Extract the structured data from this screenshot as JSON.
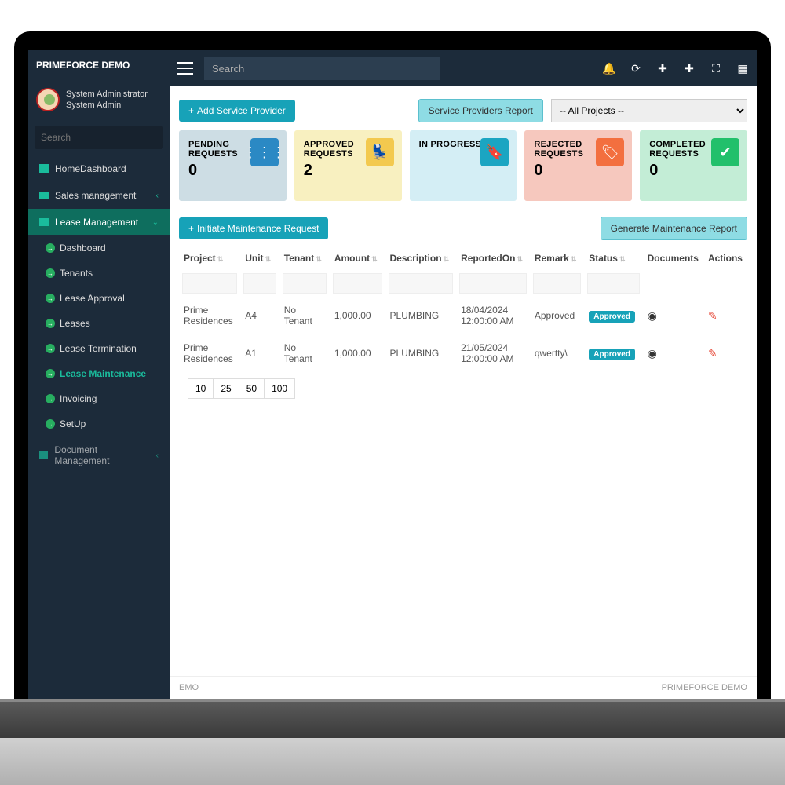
{
  "brand": "PRIMEFORCE DEMO",
  "user": {
    "name": "System Administrator",
    "role": "System Admin"
  },
  "topSearchPlaceholder": "Search",
  "sideSearchPlaceholder": "Search",
  "menu": {
    "home": "HomeDashboard",
    "sales": "Sales management",
    "lease": "Lease Management",
    "docmgmt": "Document Management",
    "sub": {
      "dashboard": "Dashboard",
      "tenants": "Tenants",
      "leaseApproval": "Lease Approval",
      "leases": "Leases",
      "leaseTermination": "Lease Termination",
      "leaseMaintenance": "Lease Maintenance",
      "invoicing": "Invoicing",
      "setup": "SetUp"
    }
  },
  "buttons": {
    "addServiceProvider": "Add Service Provider",
    "serviceProvidersReport": "Service Providers Report",
    "initiateRequest": "Initiate Maintenance Request",
    "generateReport": "Generate Maintenance Report"
  },
  "projectSelect": "-- All Projects --",
  "cards": {
    "pending": {
      "title": "PENDING REQUESTS",
      "value": "0"
    },
    "approved": {
      "title": "APPROVED REQUESTS",
      "value": "2"
    },
    "inprogress": {
      "title": "IN PROGRESS",
      "value": ""
    },
    "rejected": {
      "title": "REJECTED REQUESTS",
      "value": "0"
    },
    "completed": {
      "title": "COMPLETED REQUESTS",
      "value": "0"
    }
  },
  "table": {
    "headers": {
      "project": "Project",
      "unit": "Unit",
      "tenant": "Tenant",
      "amount": "Amount",
      "description": "Description",
      "reportedOn": "ReportedOn",
      "remark": "Remark",
      "status": "Status",
      "documents": "Documents",
      "actions": "Actions"
    },
    "rows": [
      {
        "project": "Prime Residences",
        "unit": "A4",
        "tenant": "No Tenant",
        "amount": "1,000.00",
        "description": "PLUMBING",
        "reportedOn": "18/04/2024 12:00:00 AM",
        "remark": "Approved",
        "status": "Approved"
      },
      {
        "project": "Prime Residences",
        "unit": "A1",
        "tenant": "No Tenant",
        "amount": "1,000.00",
        "description": "PLUMBING",
        "reportedOn": "21/05/2024 12:00:00 AM",
        "remark": "qwertty\\",
        "status": "Approved"
      }
    ]
  },
  "pager": [
    "10",
    "25",
    "50",
    "100"
  ],
  "footer": {
    "left": "EMO",
    "right": "PRIMEFORCE DEMO"
  }
}
